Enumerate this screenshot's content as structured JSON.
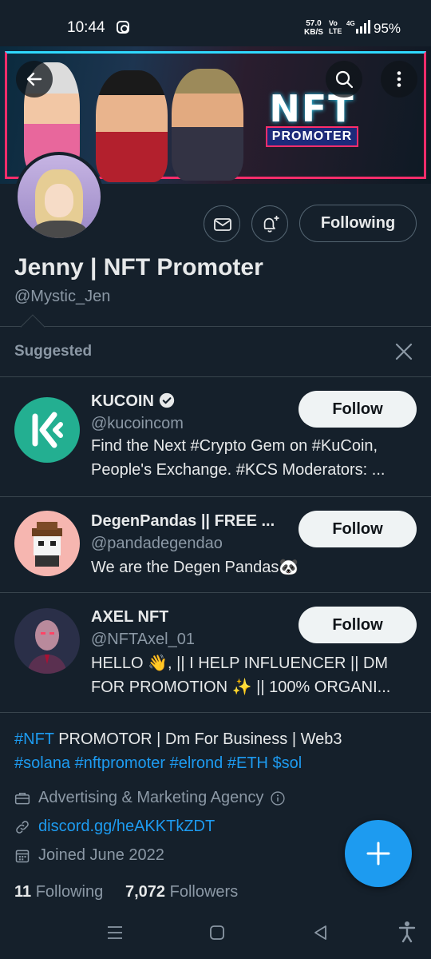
{
  "status_bar": {
    "time": "10:44",
    "speed_value": "57.0",
    "speed_unit": "KB/S",
    "volte_top": "Vo",
    "volte_bottom": "LTE",
    "network": "4G",
    "battery": "95%"
  },
  "banner": {
    "logo_text": "NFT",
    "logo_subtext": "PROMOTER",
    "accent_colors": [
      "#ff2d6b",
      "#2fd9ff"
    ]
  },
  "profile": {
    "display_name": "Jenny | NFT Promoter",
    "handle": "@Mystic_Jen",
    "following_button": "Following"
  },
  "suggested": {
    "title": "Suggested",
    "accounts": [
      {
        "name": "KUCOIN",
        "verified": true,
        "handle": "@kucoincom",
        "bio": "Find the Next #Crypto Gem on #KuCoin, People's Exchange. #KCS Moderators: ...",
        "follow_label": "Follow"
      },
      {
        "name": "DegenPandas || FREE ...",
        "verified": false,
        "handle": "@pandadegendao",
        "bio": "We are the Degen Pandas🐼",
        "follow_label": "Follow"
      },
      {
        "name": "AXEL NFT",
        "verified": false,
        "handle": "@NFTAxel_01",
        "bio": "HELLO 👋, || I HELP INFLUENCER || DM FOR PROMOTION ✨ || 100% ORGANI...",
        "follow_label": "Follow"
      }
    ]
  },
  "bio": {
    "tag_nft": "#NFT",
    "line1_rest": " PROMOTOR | Dm For Business | Web3",
    "tag_solana": "#solana",
    "tag_nftpromoter": "#nftpromoter",
    "tag_elrond": "#elrond",
    "tag_eth": "#ETH",
    "tag_sol": "$sol"
  },
  "meta": {
    "category": "Advertising & Marketing Agency",
    "link": "discord.gg/heAKKTkZDT",
    "joined": "Joined June 2022"
  },
  "counts": {
    "following_count": "11",
    "following_label": "Following",
    "followers_count": "7,072",
    "followers_label": "Followers"
  },
  "colors": {
    "background": "#15202b",
    "accent": "#1d9bf0",
    "secondary_text": "#8b98a5"
  }
}
